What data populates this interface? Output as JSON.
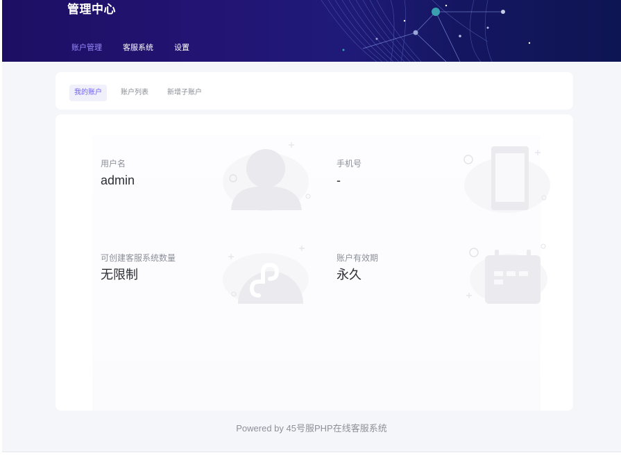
{
  "app": {
    "title": "管理中心"
  },
  "nav": {
    "items": [
      {
        "label": "账户管理",
        "active": true
      },
      {
        "label": "客服系统",
        "active": false
      },
      {
        "label": "设置",
        "active": false
      }
    ]
  },
  "subtabs": {
    "items": [
      {
        "label": "我的账户",
        "active": true
      },
      {
        "label": "账户列表",
        "active": false
      },
      {
        "label": "新增子账户",
        "active": false
      }
    ]
  },
  "account": {
    "username": {
      "label": "用户名",
      "value": "admin",
      "icon": "user-icon"
    },
    "phone": {
      "label": "手机号",
      "value": "-",
      "icon": "phone-icon"
    },
    "system_quota": {
      "label": "可创建客服系统数量",
      "value": "无限制",
      "icon": "mini-program-icon"
    },
    "validity": {
      "label": "账户有效期",
      "value": "永久",
      "icon": "calendar-icon"
    }
  },
  "footer": {
    "text": "Powered by 45号服PHP在线客服系统"
  },
  "colors": {
    "header_start": "#1c0f63",
    "header_end": "#0e1553",
    "accent": "#6a5cff",
    "active_tab_text": "#6f61f0"
  }
}
